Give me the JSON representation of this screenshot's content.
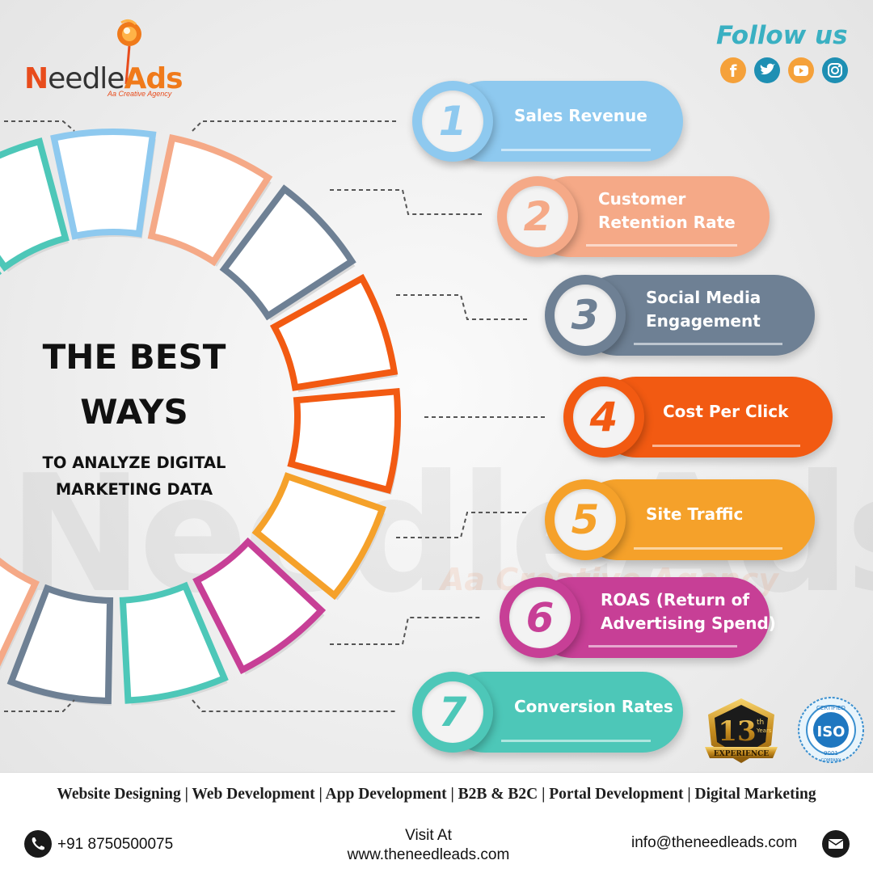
{
  "brand": {
    "logo_prefix": "N",
    "logo_mid": "eedle",
    "logo_suffix": "Ads",
    "tagline": "Aa Creative Agency",
    "watermark": "NeedleAds",
    "watermark_tagline": "Aa Creative Agency"
  },
  "follow": {
    "label": "Follow us",
    "icons": [
      {
        "name": "facebook-icon",
        "color": "#f5a13a"
      },
      {
        "name": "twitter-icon",
        "color": "#1e8fb3"
      },
      {
        "name": "youtube-icon",
        "color": "#f5a13a"
      },
      {
        "name": "instagram-icon",
        "color": "#1e8fb3"
      }
    ]
  },
  "headline": {
    "line1": "THE BEST",
    "line2": "WAYS",
    "sub_line1": "TO ANALYZE DIGITAL",
    "sub_line2": "MARKETING DATA"
  },
  "items": [
    {
      "number": "1",
      "line1": "Sales Revenue",
      "line2": "",
      "color": "#8ec9ef"
    },
    {
      "number": "2",
      "line1": "Customer",
      "line2": "Retention Rate",
      "color": "#f5a987"
    },
    {
      "number": "3",
      "line1": "Social Media",
      "line2": "Engagement",
      "color": "#6e8094"
    },
    {
      "number": "4",
      "line1": "Cost Per Click",
      "line2": "",
      "color": "#f25a12"
    },
    {
      "number": "5",
      "line1": "Site Traffic",
      "line2": "",
      "color": "#f5a12a"
    },
    {
      "number": "6",
      "line1": "ROAS (Return of",
      "line2": "Advertising Spend)",
      "color": "#c73f96"
    },
    {
      "number": "7",
      "line1": "Conversion Rates",
      "line2": "",
      "color": "#4dc7b8"
    }
  ],
  "badges": {
    "experience_number": "13",
    "experience_sup": "th",
    "experience_years": "Years",
    "experience_label": "EXPERIENCE",
    "iso_top": "CERTIFIED",
    "iso_mid": "ISO",
    "iso_num": "9001",
    "iso_bottom": "COMPANY"
  },
  "services_text": "Website Designing | Web Development | App Development | B2B & B2C | Portal Development | Digital Marketing",
  "footer": {
    "phone": "+91 8750500075",
    "visit_label": "Visit At",
    "website": "www.theneedleads.com",
    "email": "info@theneedleads.com"
  }
}
